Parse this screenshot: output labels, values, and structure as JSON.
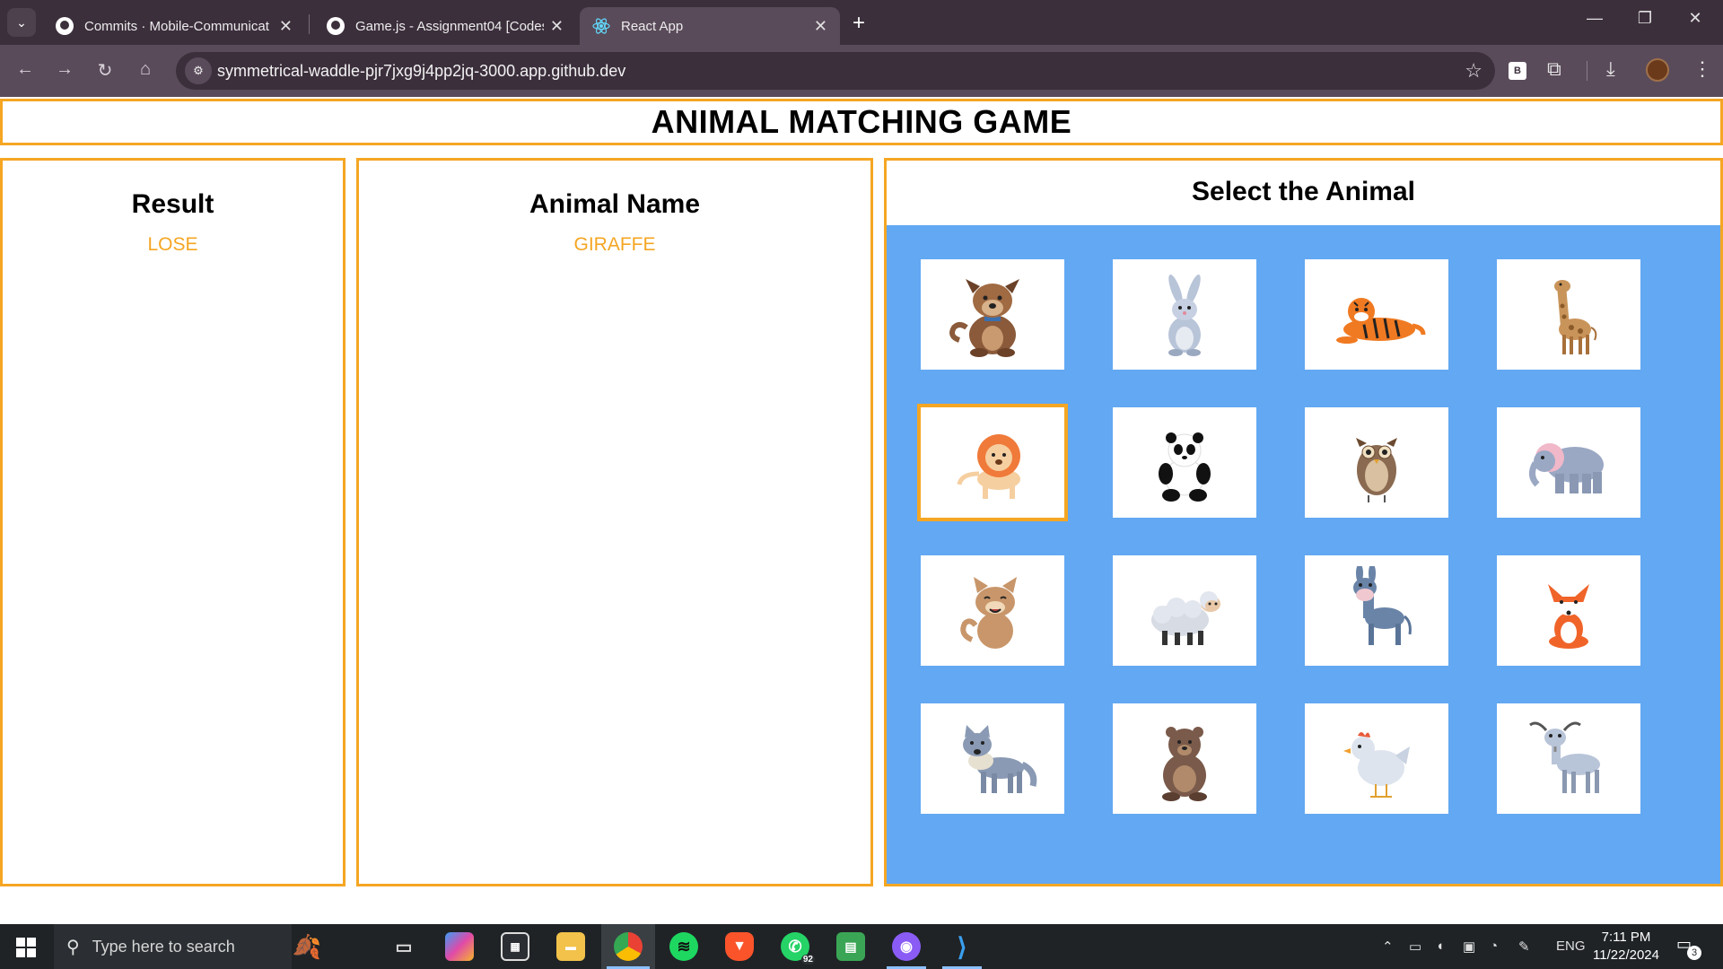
{
  "browser": {
    "tabs": [
      {
        "title": "Commits · Mobile-Communicat",
        "icon": "github-icon",
        "active": false
      },
      {
        "title": "Game.js - Assignment04 [Codes",
        "icon": "github-icon",
        "active": false
      },
      {
        "title": "React App",
        "icon": "react-icon",
        "active": true
      }
    ],
    "url": "symmetrical-waddle-pjr7jxg9j4pp2jq-3000.app.github.dev",
    "extension_label": "B"
  },
  "game": {
    "title": "ANIMAL MATCHING GAME",
    "result": {
      "heading": "Result",
      "value": "LOSE"
    },
    "animal_name": {
      "heading": "Animal Name",
      "value": "GIRAFFE"
    },
    "select": {
      "heading": "Select the Animal"
    },
    "animals": [
      {
        "name": "dog",
        "selected": false
      },
      {
        "name": "rabbit",
        "selected": false
      },
      {
        "name": "tiger",
        "selected": false
      },
      {
        "name": "giraffe",
        "selected": false
      },
      {
        "name": "lion",
        "selected": true
      },
      {
        "name": "panda",
        "selected": false
      },
      {
        "name": "owl",
        "selected": false
      },
      {
        "name": "elephant",
        "selected": false
      },
      {
        "name": "cat",
        "selected": false
      },
      {
        "name": "sheep",
        "selected": false
      },
      {
        "name": "donkey",
        "selected": false
      },
      {
        "name": "fox",
        "selected": false
      },
      {
        "name": "wolf",
        "selected": false
      },
      {
        "name": "bear",
        "selected": false
      },
      {
        "name": "chicken",
        "selected": false
      },
      {
        "name": "goat",
        "selected": false
      }
    ],
    "colors": {
      "accent": "#f5a623",
      "grid_background": "#62a8f2"
    }
  },
  "taskbar": {
    "search_placeholder": "Type here to search",
    "whatsapp_badge": "92",
    "language": "ENG",
    "time": "7:11 PM",
    "date": "11/22/2024",
    "notifications": "3"
  }
}
